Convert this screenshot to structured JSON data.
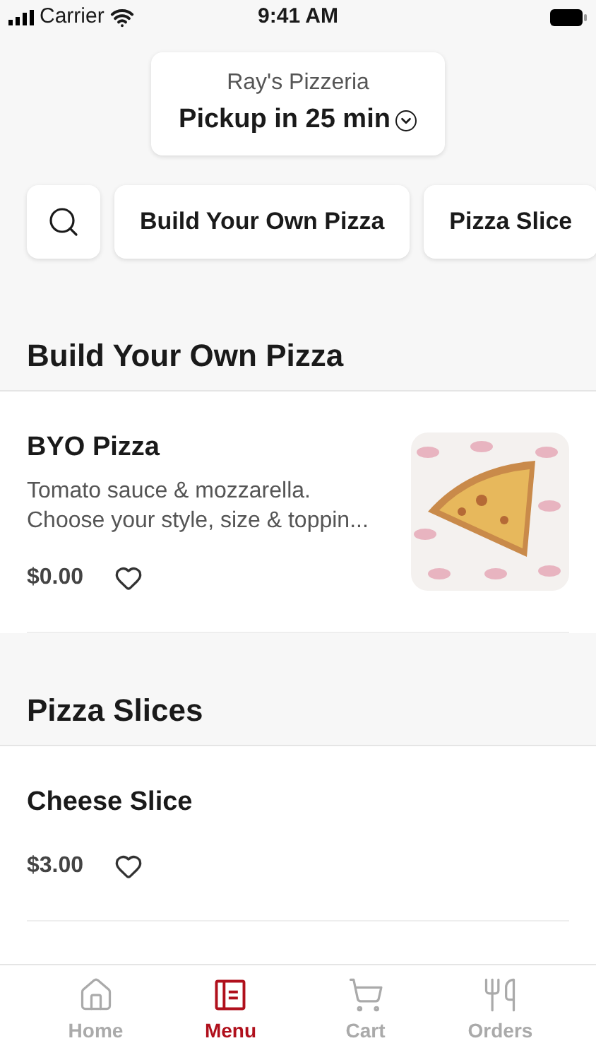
{
  "status_bar": {
    "carrier": "Carrier",
    "time": "9:41 AM"
  },
  "store": {
    "name": "Ray's Pizzeria",
    "pickup": "Pickup in 25 min"
  },
  "categories": [
    {
      "label": "Build Your Own Pizza"
    },
    {
      "label": "Pizza Slice"
    }
  ],
  "sections": [
    {
      "title": "Build Your Own Pizza",
      "items": [
        {
          "name": "BYO Pizza",
          "description": "Tomato sauce & mozzarella. Choose your style, size & toppin...",
          "price": "$0.00",
          "favorite": false
        }
      ]
    },
    {
      "title": "Pizza Slices",
      "items": [
        {
          "name": "Cheese Slice",
          "price": "$3.00",
          "favorite": false
        }
      ]
    }
  ],
  "tabs": [
    {
      "label": "Home",
      "kind": "home",
      "selected": false
    },
    {
      "label": "Menu",
      "kind": "menu",
      "selected": true
    },
    {
      "label": "Cart",
      "kind": "cart",
      "selected": false
    },
    {
      "label": "Orders",
      "kind": "orders",
      "selected": false
    }
  ]
}
